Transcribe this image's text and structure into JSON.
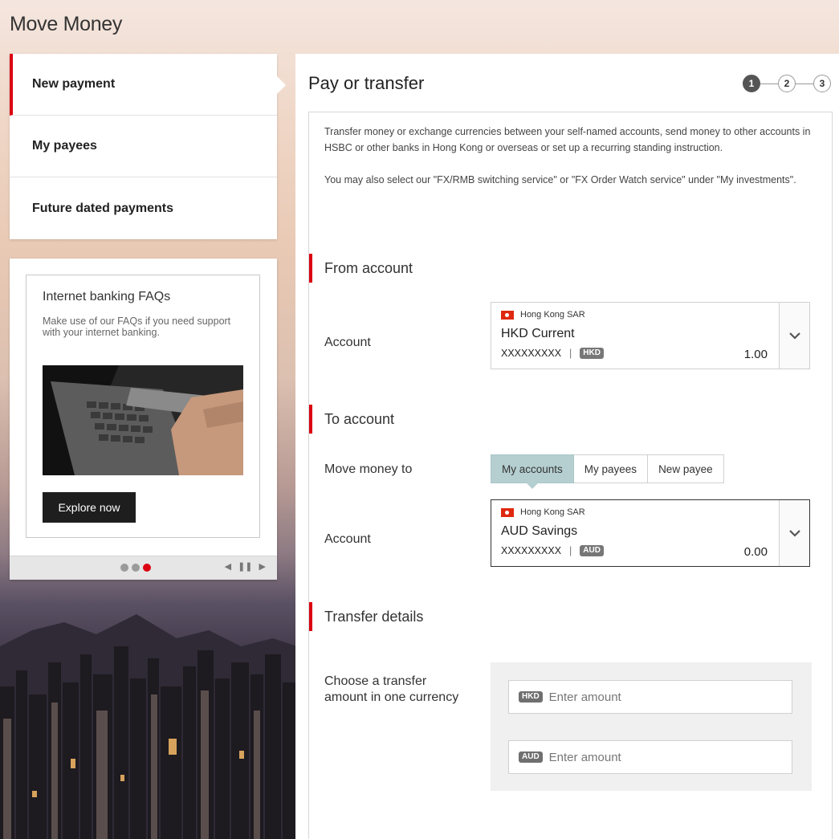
{
  "page": {
    "title": "Move Money"
  },
  "left_nav": {
    "items": [
      {
        "label": "New payment",
        "active": true
      },
      {
        "label": "My payees",
        "active": false
      },
      {
        "label": "Future dated payments",
        "active": false
      }
    ]
  },
  "promo": {
    "title": "Internet banking FAQs",
    "text": "Make use of our FAQs if you need support with your internet banking.",
    "button_label": "Explore now",
    "carousel": {
      "total": 3,
      "active_index": 3,
      "prev_icon": "◀",
      "pause_icon": "❚❚",
      "next_icon": "▶"
    }
  },
  "main": {
    "title": "Pay or transfer",
    "steps": [
      "1",
      "2",
      "3"
    ],
    "active_step": 1,
    "intro_p1": "Transfer money or exchange currencies between your self-named accounts, send money to other accounts in HSBC or other banks in Hong Kong or overseas or set up a recurring standing instruction.",
    "intro_p2": "You may also select our \"FX/RMB switching service\" or \"FX Order Watch service\" under \"My investments\"."
  },
  "from_account": {
    "heading": "From account",
    "label": "Account",
    "region": "Hong Kong SAR",
    "name": "HKD Current",
    "number": "XXXXXXXXX",
    "separator": "|",
    "currency": "HKD",
    "balance": "1.00"
  },
  "to_account": {
    "heading": "To account",
    "move_label": "Move money to",
    "tabs": [
      {
        "label": "My accounts",
        "active": true
      },
      {
        "label": "My payees",
        "active": false
      },
      {
        "label": "New payee",
        "active": false
      }
    ],
    "label": "Account",
    "region": "Hong Kong SAR",
    "name": "AUD Savings",
    "number": "XXXXXXXXX",
    "separator": "|",
    "currency": "AUD",
    "balance": "0.00"
  },
  "transfer_details": {
    "heading": "Transfer details",
    "amount_label": "Choose a transfer amount in one currency",
    "inputs": [
      {
        "currency": "HKD",
        "placeholder": "Enter amount",
        "value": ""
      },
      {
        "currency": "AUD",
        "placeholder": "Enter amount",
        "value": ""
      }
    ]
  },
  "colors": {
    "accent": "#db0011",
    "tab_active": "#b5cfd1",
    "badge": "#777777"
  }
}
